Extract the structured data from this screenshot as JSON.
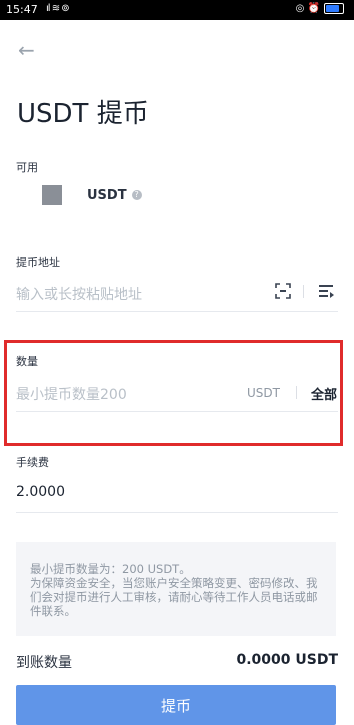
{
  "status_bar": {
    "time": "15:47",
    "signal": "²ⱼ⹾ ≋ ®",
    "icons": "© ⏰"
  },
  "header": {
    "back_icon": "arrow-left-icon",
    "title": "USDT 提币"
  },
  "available": {
    "label": "可用",
    "coin": "USDT",
    "help_icon": "question-icon"
  },
  "address": {
    "label": "提币地址",
    "placeholder": "输入或长按粘贴地址",
    "scan_icon": "scan-icon",
    "address_book_icon": "address-book-icon"
  },
  "amount": {
    "label": "数量",
    "placeholder": "最小提币数量200",
    "unit": "USDT",
    "all_label": "全部"
  },
  "fee": {
    "label": "手续费",
    "value": "2.0000"
  },
  "notice": {
    "line1": "最小提币数量为：200 USDT。",
    "line2": "为保障资金安全，当您账户安全策略变更、密码修改、我们会对提币进行人工审核，请耐心等待工作人员电话或邮件联系。"
  },
  "footer": {
    "arrive_label": "到账数量",
    "arrive_value": "0.0000 USDT",
    "submit_label": "提币"
  },
  "colors": {
    "highlight": "#e02b2b",
    "button": "#6095e8"
  }
}
